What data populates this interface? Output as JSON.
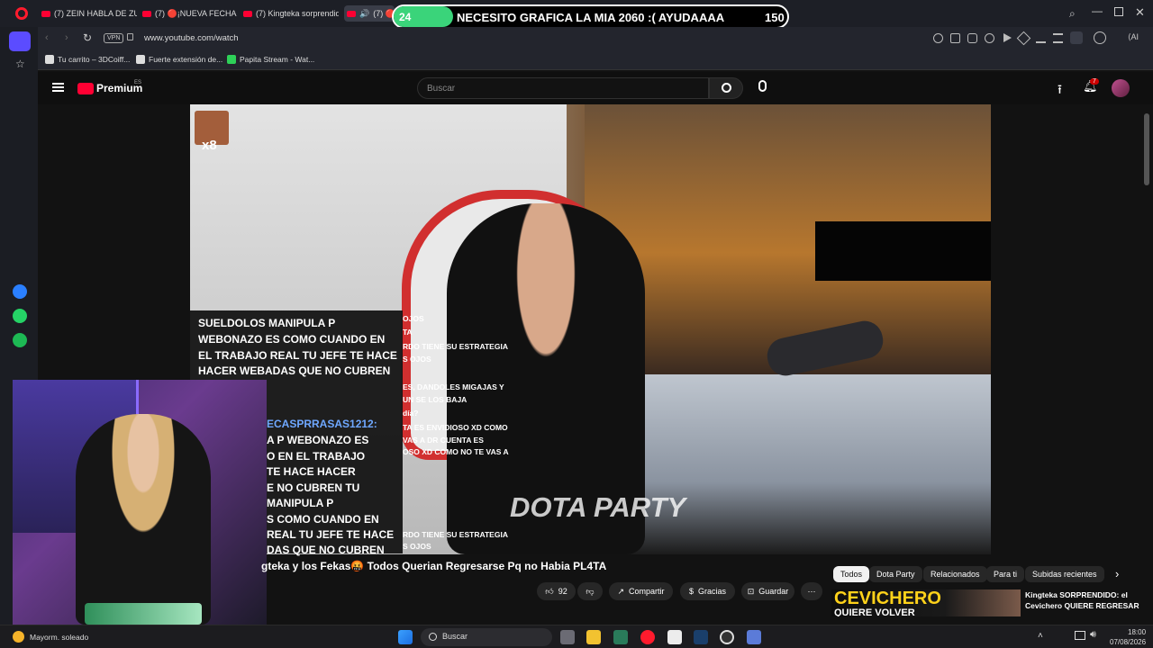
{
  "browser": {
    "tabs": [
      {
        "label": "(7) ZEIN HABLA DE ZULLY"
      },
      {
        "label": "(7) 🔴¡NUEVA FECHA par"
      },
      {
        "label": "(7) Kingteka sorprendido"
      },
      {
        "label": "(7) 🔴R"
      }
    ],
    "url": "www.youtube.com/watch",
    "vpn_label": "VPN",
    "ai_label": "AI",
    "bookmarks": [
      {
        "label": "Tu carrito – 3DCoiff..."
      },
      {
        "label": "Fuerte extensión de..."
      },
      {
        "label": "Papita Stream - Wat..."
      }
    ]
  },
  "donation_banner": {
    "counter": "24",
    "message": "NECESITO GRAFICA LA MIA 2060 :( AYUDAAAA",
    "amount": "150",
    "progress": 0.15
  },
  "youtube": {
    "logo_label": "Premium",
    "region": "ES",
    "search_placeholder": "Buscar",
    "notification_count": "7"
  },
  "video": {
    "emote_multiplier": "x8",
    "watermark": "DOTA PARTY",
    "chat_lines": [
      "SUELDOLOS MANIPULA P",
      "WEBONAZO ES COMO CUANDO EN",
      "EL TRABAJO REAL TU JEFE TE HACE",
      "HACER WEBADAS QUE NO CUBREN"
    ],
    "side_lines": [
      "OJOS",
      "TA",
      "RDO TIENE SU ESTRATEGIA",
      "S OJOS",
      "ES, DANDOLES MIGAJAS Y",
      "UN SE LOS BAJA",
      "día?",
      "TA ES ENVIDIOSO XD COMO",
      "VAS A DR CUENTA ES",
      "OSO XD COMO NO TE VAS A",
      "RDO TIENE SU ESTRATEGIA",
      "S OJOS"
    ],
    "lower_chat": [
      "ECASPRRASAS1212:",
      "A P WEBONAZO ES",
      "O EN EL TRABAJO",
      "TE HACE HACER",
      "E NO CUBREN TU",
      "MANIPULA P",
      "S COMO CUANDO EN",
      "REAL TU JEFE TE HACE",
      "DAS QUE NO CUBREN"
    ]
  },
  "video_info": {
    "title": "gteka y los Fekas🤬 Todos Querian Regresarse Pq no Habia PL4TA",
    "like_count": "92",
    "share_label": "Compartir",
    "thanks_label": "Gracias",
    "save_label": "Guardar"
  },
  "chips": [
    {
      "label": "Todos",
      "active": true
    },
    {
      "label": "Dota Party"
    },
    {
      "label": "Relacionados"
    },
    {
      "label": "Para ti"
    },
    {
      "label": "Subidas recientes"
    }
  ],
  "recommendation": {
    "thumb_text": "CEVICHERO",
    "thumb_sub": "QUIERE VOLVER",
    "title_line1": "Kingteka SORPRENDIDO: el",
    "title_line2": "Cevichero QUIERE REGRESAR"
  },
  "taskbar": {
    "weather": "Mayorm. soleado",
    "search_label": "Buscar",
    "time": "18:00",
    "date": "07/08/2026"
  },
  "colors": {
    "accent_red": "#ff0033",
    "banner_green": "#3ad47a"
  }
}
